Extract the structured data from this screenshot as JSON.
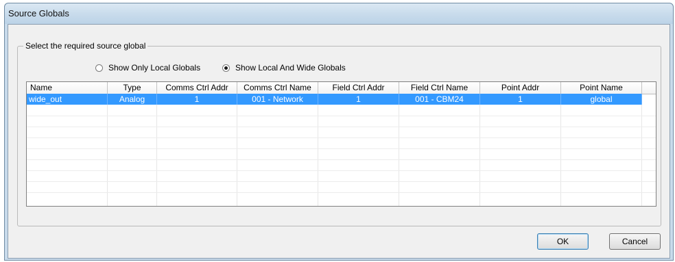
{
  "window": {
    "title": "Source Globals"
  },
  "group": {
    "label": "Select the required source global"
  },
  "radios": [
    {
      "label": "Show Only Local Globals",
      "checked": false
    },
    {
      "label": "Show Local And Wide Globals",
      "checked": true
    }
  ],
  "table": {
    "columns": [
      "Name",
      "Type",
      "Comms Ctrl Addr",
      "Comms Ctrl Name",
      "Field Ctrl Addr",
      "Field Ctrl Name",
      "Point Addr",
      "Point Name"
    ],
    "rows": [
      [
        "wide_out",
        "Analog",
        "1",
        "001 - Network",
        "1",
        "001 - CBM24",
        "1",
        "global"
      ]
    ],
    "selected_row": 0
  },
  "buttons": {
    "ok": "OK",
    "cancel": "Cancel"
  },
  "colors": {
    "selection": "#3399ff",
    "titlebar": "#c9dbeb"
  }
}
